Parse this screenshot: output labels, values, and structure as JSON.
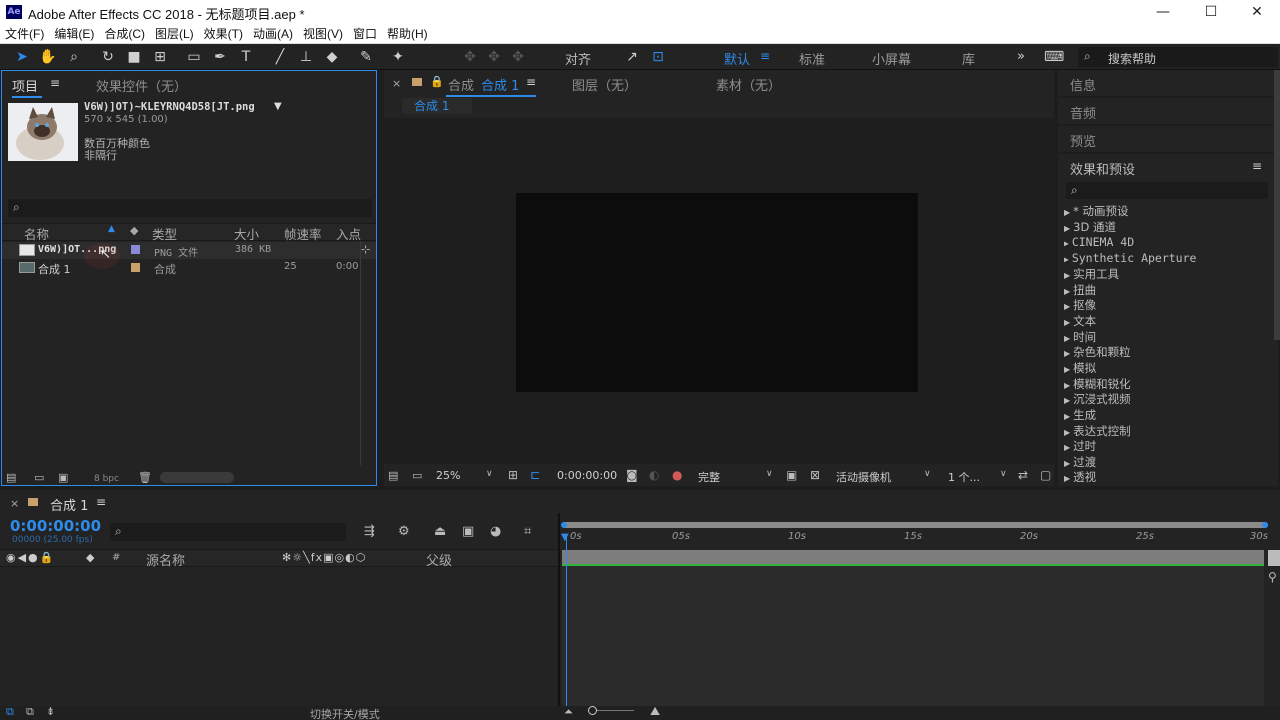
{
  "window": {
    "app_logo": "Ae",
    "title": "Adobe After Effects CC 2018 - 无标题项目.aep *",
    "minimize": "—",
    "maximize": "☐",
    "close": "✕"
  },
  "menu": [
    "文件(F)",
    "编辑(E)",
    "合成(C)",
    "图层(L)",
    "效果(T)",
    "动画(A)",
    "视图(V)",
    "窗口",
    "帮助(H)"
  ],
  "toolbar": {
    "align_label": "对齐",
    "workspaces": [
      "默认",
      "标准",
      "小屏幕",
      "库"
    ],
    "more": "»",
    "search_placeholder": "搜索帮助"
  },
  "project_panel": {
    "tab_label": "项目",
    "effects_tab_label": "效果控件（无）",
    "preview_name": "V6W)]OT)~KLEYRNQ4D58[JT.png",
    "preview_dims": "570 x 545 (1.00)",
    "preview_colors": "数百万种颜色",
    "preview_interlace": "非隔行",
    "columns": {
      "name": "名称",
      "type": "类型",
      "size": "大小",
      "fps": "帧速率",
      "in": "入点"
    },
    "rows": [
      {
        "name": "V6W)]OT...png",
        "type": "PNG 文件",
        "size": "386 KB",
        "fps": "",
        "in": "",
        "label_color": "#8a8ad8"
      },
      {
        "name": "合成 1",
        "type": "合成",
        "size": "",
        "fps": "25",
        "in": "0:00",
        "label_color": "#c8a26a"
      }
    ],
    "bpc": "8 bpc"
  },
  "comp_panel": {
    "tab_label": "合成",
    "comp_name": "合成 1",
    "layer_tab": "图层（无）",
    "footage_tab": "素材（无）",
    "breadcrumb": "合成 1",
    "zoom": "25%",
    "timecode": "0:00:00:00",
    "resolution": "完整",
    "camera": "活动摄像机",
    "views": "1 个..."
  },
  "right_panel": {
    "info": "信息",
    "audio": "音频",
    "preview": "预览",
    "effects_title": "效果和预设",
    "effects": [
      "* 动画预设",
      "3D 通道",
      "CINEMA 4D",
      "Synthetic Aperture",
      "实用工具",
      "扭曲",
      "抠像",
      "文本",
      "时间",
      "杂色和颗粒",
      "模拟",
      "模糊和锐化",
      "沉浸式视频",
      "生成",
      "表达式控制",
      "过时",
      "过渡",
      "透视"
    ]
  },
  "timeline": {
    "tab_label": "合成 1",
    "timecode": "0:00:00:00",
    "frame_info": "00000 (25.00 fps)",
    "source_name_col": "源名称",
    "parent_col": "父级",
    "hash_col": "#",
    "ruler": [
      "0s",
      "05s",
      "10s",
      "15s",
      "20s",
      "25s",
      "30s"
    ],
    "footer_label": "切换开关/模式"
  }
}
